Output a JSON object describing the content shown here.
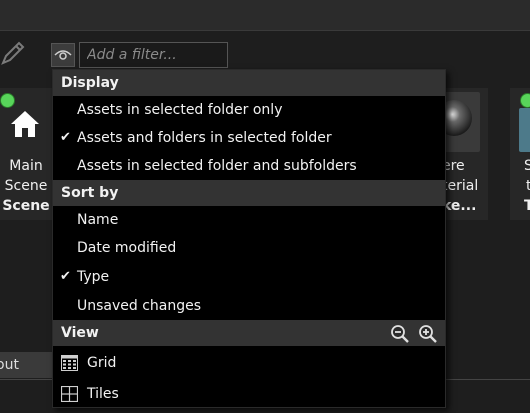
{
  "filter": {
    "placeholder": "Add a filter..."
  },
  "assets": {
    "main_card": {
      "name_line1": "Main",
      "name_line2": "Scene",
      "type": "Scene"
    },
    "sphere_card": {
      "name_line1": "ere",
      "name_line2": "terial",
      "type": "ke..."
    },
    "right_card": {
      "name_line1": "S",
      "name_line2": "t",
      "type": "T"
    }
  },
  "bottom_tab": {
    "label": "out"
  },
  "dropdown": {
    "display": {
      "header": "Display",
      "items": [
        {
          "label": "Assets in selected folder only",
          "checked": false
        },
        {
          "label": "Assets and folders in selected folder",
          "checked": true
        },
        {
          "label": "Assets in selected folder and subfolders",
          "checked": false
        }
      ]
    },
    "sort": {
      "header": "Sort by",
      "items": [
        {
          "label": "Name",
          "checked": false
        },
        {
          "label": "Date modified",
          "checked": false
        },
        {
          "label": "Type",
          "checked": true
        },
        {
          "label": "Unsaved changes",
          "checked": false
        }
      ]
    },
    "view": {
      "header": "View",
      "items": [
        {
          "label": "Grid",
          "icon": "grid-icon"
        },
        {
          "label": "Tiles",
          "icon": "tiles-icon"
        }
      ]
    },
    "check_glyph": "✔"
  },
  "colors": {
    "status_dot": "#58d45a",
    "menu_bg": "#000000",
    "header_bg": "#333333"
  }
}
